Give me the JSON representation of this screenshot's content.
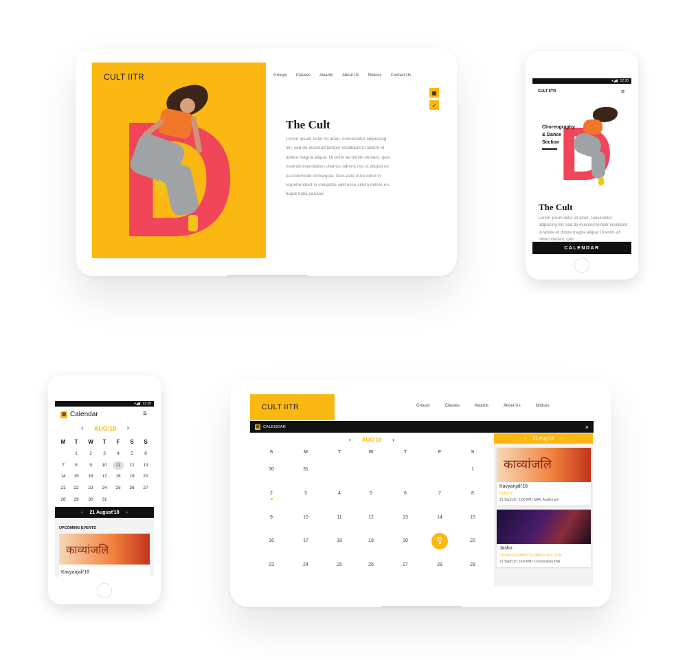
{
  "brand": "CULT IITR",
  "nav": [
    "Groups",
    "Classes",
    "Awards",
    "About Us",
    "Notices",
    "Contact Us"
  ],
  "nav_short": [
    "Groups",
    "Classes",
    "Awards",
    "About Us",
    "Notices"
  ],
  "about": {
    "title": "The Cult",
    "body": "Lorem ipsum dolor sit amet, consectetur adipiscing elit, sed do eiusmod tempor incididunt ut labore et dolore magna aliqua. Ut enim ad minim veniam, quis nostrud exercitation ullamco laboris nisi ut aliquip ex ea commodo consequat. Duis aute irure dolor in reprehenderit in voluptate velit esse cillum dolore eu fugiat nulla pariatur.",
    "body_mobile": "Lorem ipsum dolor sit amet, consectetur adipiscing elit, sed do eiusmod tempor incididunt ut labore et dolore magna aliqua. Ut enim ad minim veniam, quis"
  },
  "hero_letter": "D",
  "mobile_hero": {
    "tagline_1": "Choreography",
    "tagline_2": "& Dance",
    "tagline_3": "Section",
    "calendar_button": "CALENDAR"
  },
  "status_time": "12:30",
  "colors": {
    "accent": "#fbb812",
    "hero_red": "#f1455a",
    "dark": "#1a1a1a"
  },
  "calendar": {
    "label": "CALENDAR",
    "title": "Calendar",
    "month": "AUG'18",
    "selected_date": "21 Aug'18",
    "selected_date_long": "21 August'18",
    "weekdays_full": [
      "S",
      "M",
      "T",
      "W",
      "T",
      "F",
      "S"
    ],
    "weekdays_phone": [
      "M",
      "T",
      "W",
      "T",
      "F",
      "S",
      "S"
    ],
    "weeks_desktop": [
      [
        "30",
        "31",
        "",
        "",
        "",
        "",
        "1"
      ],
      [
        "2",
        "3",
        "4",
        "5",
        "6",
        "7",
        "8"
      ],
      [
        "9",
        "10",
        "11",
        "12",
        "13",
        "14",
        "15"
      ],
      [
        "16",
        "17",
        "18",
        "19",
        "20",
        "21",
        "22"
      ],
      [
        "23",
        "24",
        "25",
        "26",
        "27",
        "28",
        "29"
      ]
    ],
    "weeks_phone": [
      [
        "",
        "1",
        "2",
        "3",
        "4",
        "5",
        "6"
      ],
      [
        "7",
        "8",
        "9",
        "10",
        "11",
        "12",
        "13"
      ],
      [
        "14",
        "15",
        "16",
        "17",
        "18",
        "19",
        "20"
      ],
      [
        "21",
        "22",
        "23",
        "24",
        "25",
        "26",
        "27"
      ],
      [
        "28",
        "29",
        "30",
        "31",
        "",
        "",
        ""
      ]
    ],
    "upcoming_label": "UPCOMING EVENTS",
    "close_glyph": "×",
    "prev_glyph": "‹",
    "next_glyph": "›"
  },
  "events": [
    {
      "title": "Kavyanjali'18",
      "org": "KSHITIJ",
      "meta": "21 Sept'18 | 6:00 PM | MAC Auditorium",
      "poster_text": "काव्यांजलि"
    },
    {
      "title": "Jashn",
      "org": "CHOREOGRAPHY & DANCE SECTION",
      "meta": "21 Sept'18 | 6:00 PM | Convocation Hall"
    }
  ]
}
